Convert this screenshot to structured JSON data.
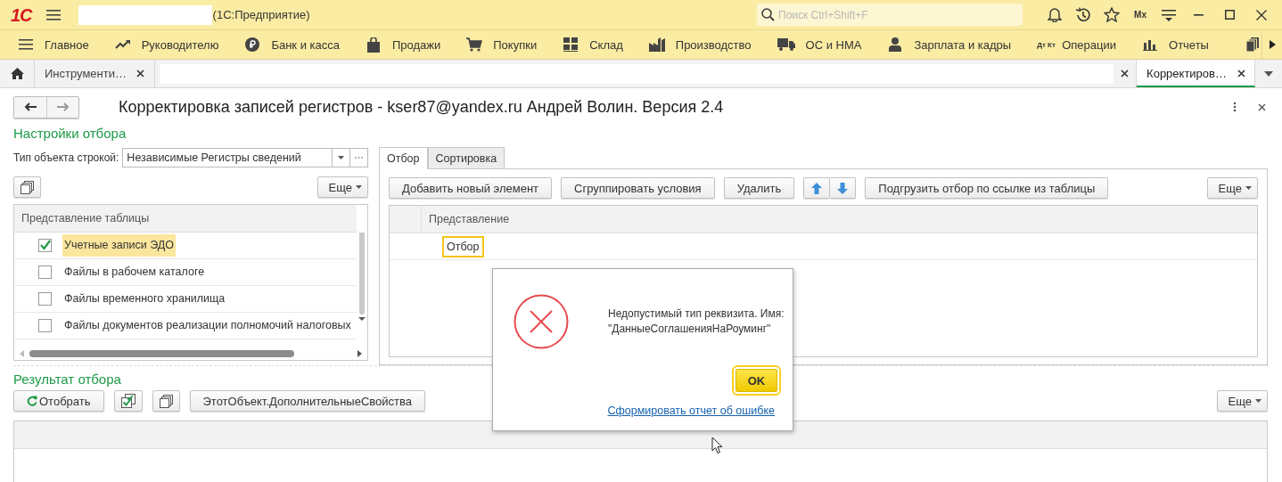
{
  "app": {
    "logo": "1С",
    "title": "(1С:Предприятие)",
    "search": {
      "placeholder": "Поиск Ctrl+Shift+F"
    },
    "user": "Мх"
  },
  "sections": [
    {
      "label": "Главное"
    },
    {
      "label": "Руководителю"
    },
    {
      "label": "Банк и касса"
    },
    {
      "label": "Продажи"
    },
    {
      "label": "Покупки"
    },
    {
      "label": "Склад"
    },
    {
      "label": "Производство"
    },
    {
      "label": "ОС и НМА"
    },
    {
      "label": "Зарплата и кадры"
    },
    {
      "label": "Операции",
      "icon_text": "Дт Кт"
    },
    {
      "label": "Отчеты"
    }
  ],
  "open_tabs": [
    {
      "kind": "home"
    },
    {
      "kind": "tab",
      "label": "Инструменти…",
      "selected": false
    },
    {
      "kind": "blank"
    },
    {
      "kind": "tab",
      "label": "Корректиров…",
      "selected": true
    }
  ],
  "form": {
    "title": "Корректировка записей регистров - kser87@yandex.ru Андрей Волин. Версия 2.4",
    "filter_settings": {
      "heading": "Настройки отбора",
      "type_label": "Тип объекта строкой:",
      "type_value": "Независимые Регистры сведений",
      "more": "Еще",
      "table": {
        "column": "Представление таблицы",
        "rows": [
          {
            "label": "Учетные записи ЭДО",
            "checked": true,
            "selected": true
          },
          {
            "label": "Файлы в рабочем каталоге",
            "checked": false,
            "selected": false
          },
          {
            "label": "Файлы временного хранилища",
            "checked": false,
            "selected": false
          },
          {
            "label": "Файлы документов реализации полномочий налоговых",
            "checked": false,
            "selected": false
          }
        ]
      }
    },
    "filter_editor": {
      "tabs": [
        {
          "label": "Отбор",
          "selected": true
        },
        {
          "label": "Сортировка",
          "selected": false
        }
      ],
      "buttons": [
        {
          "kind": "text",
          "label": "Добавить новый элемент"
        },
        {
          "kind": "text",
          "label": "Сгруппировать условия"
        },
        {
          "kind": "text",
          "label": "Удалить"
        },
        {
          "kind": "arrows"
        },
        {
          "kind": "text",
          "label": "Подгрузить отбор по ссылке из таблицы"
        }
      ],
      "more": "Еще",
      "table": {
        "column": "Представление",
        "rows": [
          {
            "label": "Отбор",
            "selected": true
          }
        ]
      }
    },
    "result": {
      "heading": "Результат отбора",
      "buttons": [
        {
          "kind": "refresh",
          "label": "Отобрать"
        },
        {
          "kind": "check-all"
        },
        {
          "kind": "copy"
        },
        {
          "kind": "text",
          "label": "ЭтотОбъект.ДополнительныеСвойства"
        }
      ],
      "more": "Еще"
    }
  },
  "dialog": {
    "message": "Недопустимый тип реквизита. Имя:\n\"ДанныеСоглашенияНаРоуминг\"",
    "ok": "OK",
    "link": "Сформировать отчет об ошибке"
  }
}
